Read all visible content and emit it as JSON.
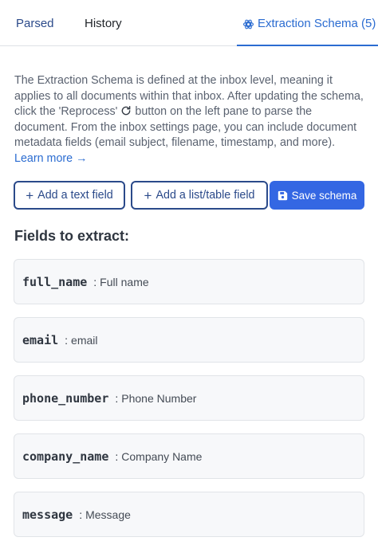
{
  "tabs": {
    "parsed": "Parsed",
    "history": "History",
    "schema": "Extraction Schema (5)"
  },
  "intro": {
    "part1": "The Extraction Schema is defined at the inbox level, meaning it applies to all documents within that inbox. After updating the schema, click the 'Reprocess' ",
    "part2": " button on the left pane to parse the document. From the inbox settings page, you can include document metadata fields (email subject, filename, timestamp, and more). ",
    "learn_more": "Learn more →"
  },
  "buttons": {
    "add_text_field": "Add a text field",
    "add_list_field": "Add a list/table field",
    "save_schema": "Save schema"
  },
  "fields_heading": "Fields to extract:",
  "fields": [
    {
      "key": "full_name",
      "sep": ":",
      "desc": "Full name"
    },
    {
      "key": "email",
      "sep": ":",
      "desc": "email"
    },
    {
      "key": "phone_number",
      "sep": ":",
      "desc": "Phone Number"
    },
    {
      "key": "company_name",
      "sep": ":",
      "desc": "Company Name"
    },
    {
      "key": "message",
      "sep": ":",
      "desc": "Message"
    }
  ],
  "icons": {
    "schema_tab": "openai-icon",
    "reprocess": "refresh-icon",
    "save": "floppy-disk-icon",
    "add": "plus-icon"
  },
  "colors": {
    "accent": "#2b6cd1",
    "primary_button": "#3467e3",
    "outline_button": "#2b4a8a"
  }
}
